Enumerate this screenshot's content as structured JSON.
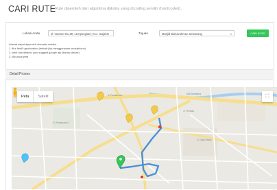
{
  "header": {
    "title": "CARI RUTE",
    "subtitle": "Rute diperoleh dari algoritma dijkstra yang dicoding sendiri (hardcoded)."
  },
  "form": {
    "origin_label": "Lokasi Anda",
    "origin_value": "Jl. Veteran No.29, Lempongsari, Kec. Gajahm",
    "destination_label": "Tujuan",
    "destination_value": "Masjid Baiturrahman Semarang",
    "search_button": "CARI RUTE"
  },
  "notes": [
    "Alamat dapat diperoleh otomatis melalui :",
    "1. fitur html5 geolocation (terbaik jika menggunakan smartphone)",
    "2. ketik dan dibantu auto suggest google api (library places)",
    "3. klik pada peta"
  ],
  "detail": {
    "label": "Detail Proses"
  },
  "map": {
    "tabs": [
      "Peta",
      "Satelit"
    ],
    "fullscreen_icon": "⛶",
    "road_labels": [
      "Jl. Pandanaran",
      "Jl. Pemuda",
      "Kali Semarang",
      "Jl. Gajah Mada",
      "Jl. Pandanaran 2"
    ],
    "colors": {
      "route": "#4a90d9",
      "start_marker": "#34c75a",
      "end_marker": "#e53935",
      "poi": "#f2c94c"
    }
  }
}
